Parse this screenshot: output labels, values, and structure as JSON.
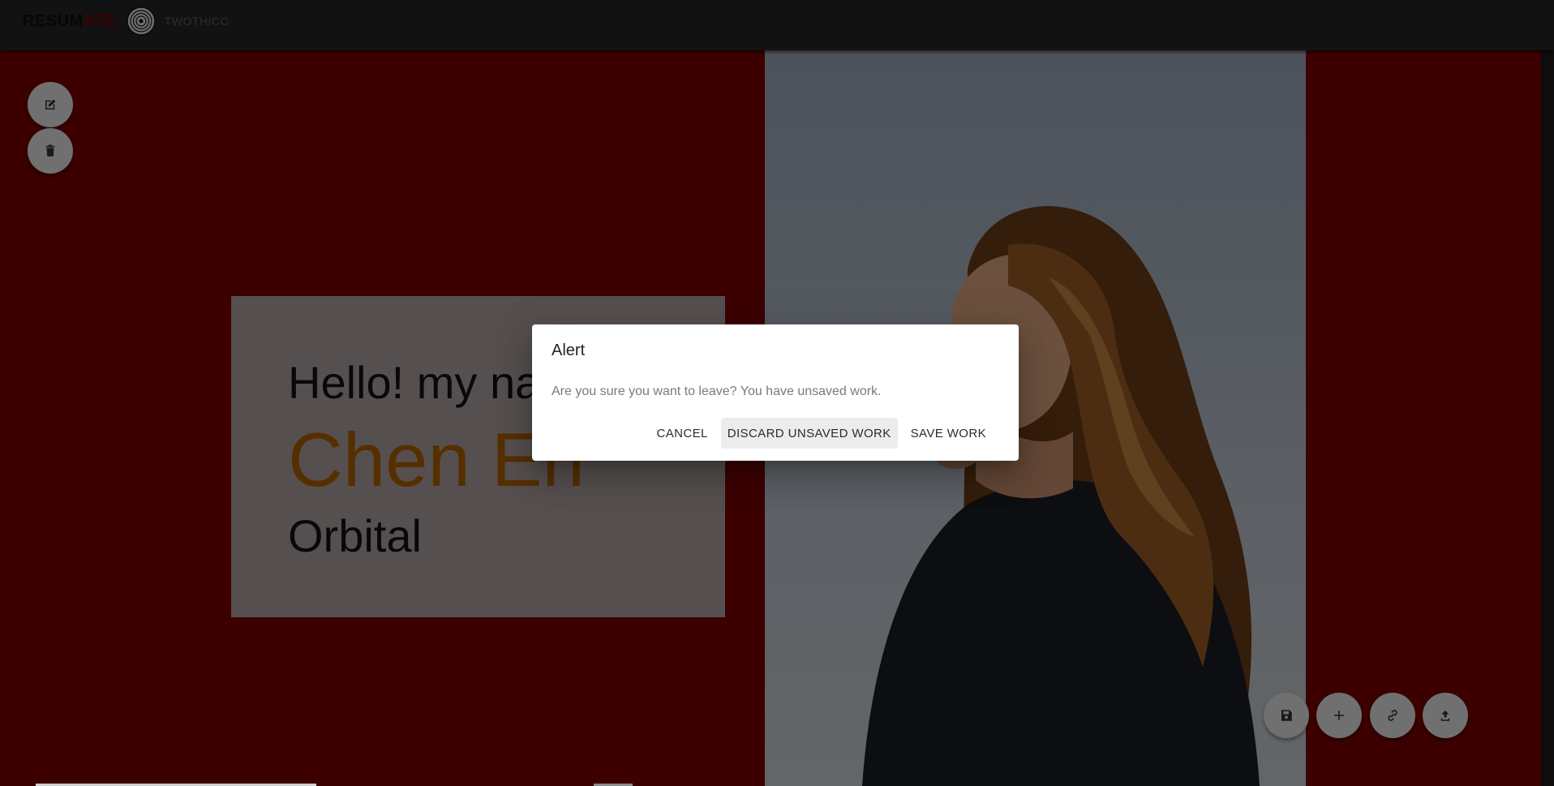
{
  "header": {
    "brand_part1": "RESUM",
    "brand_part2": "ATE",
    "username": "TWOTHICC",
    "colors": {
      "bar": "#252525",
      "brand_accent": "#7a0000"
    }
  },
  "intro": {
    "greeting": "Hello! my na",
    "name": "Chen En",
    "subtitle": "Orbital",
    "colors": {
      "background": "#780000",
      "card": "#ad9e9e",
      "name": "#ad5f00"
    }
  },
  "left_actions": [
    {
      "icon": "edit-icon",
      "label": "edit"
    },
    {
      "icon": "delete-icon",
      "label": "delete"
    }
  ],
  "bottom_actions": [
    {
      "icon": "save-icon"
    },
    {
      "icon": "add-icon"
    },
    {
      "icon": "link-icon"
    },
    {
      "icon": "upload-icon"
    }
  ],
  "dialog": {
    "title": "Alert",
    "message": "Are you sure you want to leave? You have unsaved work.",
    "cancel_label": "CANCEL",
    "discard_label": "DISCARD UNSAVED WORK",
    "save_label": "SAVE WORK"
  }
}
